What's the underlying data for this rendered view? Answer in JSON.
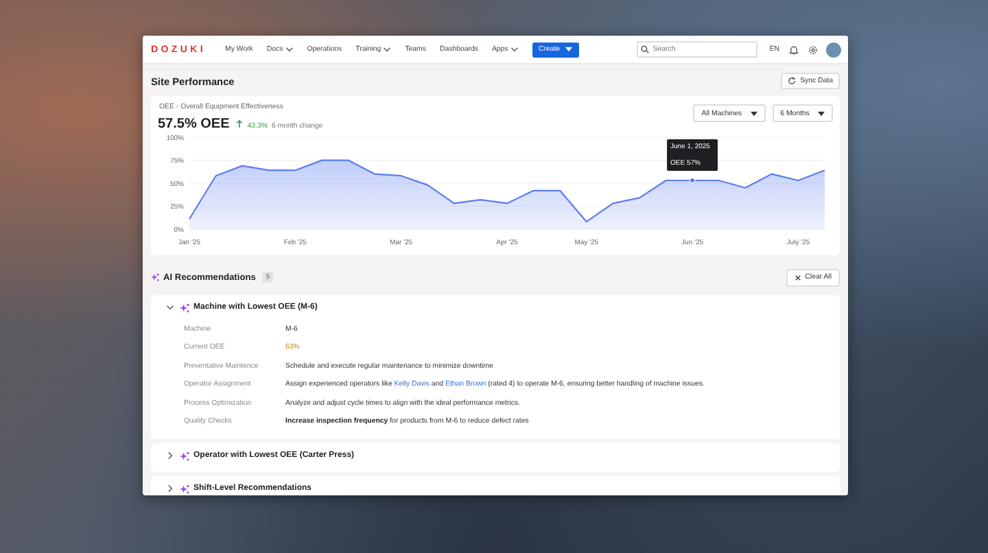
{
  "nav": {
    "logo": "DOZUKI",
    "items": [
      {
        "label": "My Work",
        "kind": "link"
      },
      {
        "label": "Docs",
        "kind": "menu"
      },
      {
        "label": "Operations",
        "kind": "link"
      },
      {
        "label": "Training",
        "kind": "menu"
      },
      {
        "label": "Teams",
        "kind": "link"
      },
      {
        "label": "Dashboards",
        "kind": "link"
      },
      {
        "label": "Apps",
        "kind": "menu"
      }
    ],
    "create_button": "Create",
    "search": {
      "placeholder": "Search"
    },
    "language": "EN"
  },
  "performance": {
    "title": "Site Performance",
    "sync_button": "Sync Data",
    "subtitle": "OEE - Overall Equipment Effectiveness",
    "metric": "57.5% OEE",
    "change": {
      "value": "43.3%",
      "label": "6 month change"
    },
    "tooltip": {
      "date": "June 1, 2025"
    },
    "filters": [
      "All Machines",
      "6 Months"
    ],
    "chart_data": {
      "type": "area",
      "categories": [
        "Jan '25",
        null,
        null,
        null,
        "Feb '25",
        null,
        null,
        null,
        "Mar '25",
        null,
        null,
        null,
        "Apr '25",
        null,
        null,
        "May '25",
        null,
        null,
        null,
        "Jun '25",
        null,
        null,
        null,
        "July '25",
        null
      ],
      "series": [
        {
          "color": "#5b7cf0",
          "values": [
            11,
            58,
            69,
            64,
            64,
            75,
            75,
            60,
            58,
            48,
            28,
            32,
            28,
            42,
            42,
            8,
            28,
            34,
            53,
            53,
            53,
            45,
            60,
            53,
            64
          ]
        }
      ],
      "ylim": [
        0,
        100
      ],
      "grid": true,
      "yticks": [
        {
          "value": 0,
          "label": "0%"
        },
        {
          "value": 25,
          "label": "25%"
        },
        {
          "value": 50,
          "label": "50%"
        },
        {
          "value": 75,
          "label": "75%"
        },
        {
          "value": 100,
          "label": "100%"
        }
      ],
      "annotations": [
        {
          "x": "Jun '25",
          "y": 53,
          "text": "OEE 57%"
        }
      ]
    }
  },
  "recommendations": {
    "title": "AI Recommendations",
    "count": "5",
    "clear_button": "Clear All",
    "items": [
      {
        "title": "Machine with Lowest OEE (M-6)",
        "expanded": true,
        "rows": [
          {
            "label": "Machine",
            "kind": "text",
            "value": "M-6"
          },
          {
            "label": "Current OEE",
            "kind": "highlight",
            "value": "63%"
          },
          {
            "label": "Preventative Maintence",
            "kind": "text",
            "value": "Schedule and execute regular maintenance to minimize downtime"
          },
          {
            "label": "Operator Assignment",
            "kind": "links",
            "parts": [
              {
                "kind": "text",
                "text": "Assign experienced operators like"
              },
              {
                "kind": "link",
                "text": "Kelly Davis"
              },
              {
                "kind": "text",
                "text": "and"
              },
              {
                "kind": "link",
                "text": "Ethan Brown"
              },
              {
                "kind": "text",
                "text": "(rated 4) to operate M-6, ensuring better handling of machine issues."
              }
            ]
          },
          {
            "label": "Process Optimization",
            "kind": "text",
            "value": "Analyze and adjust cycle times to align with the ideal performance metrics."
          },
          {
            "label": "Quality Checks",
            "kind": "text",
            "value": "**Increase inspection frequency** for products from M-6 to reduce defect rates"
          }
        ]
      },
      {
        "title": "Operator with Lowest OEE (Carter Press)",
        "expanded": false
      },
      {
        "title": "Shift-Level Recommendations",
        "expanded": false
      }
    ]
  }
}
